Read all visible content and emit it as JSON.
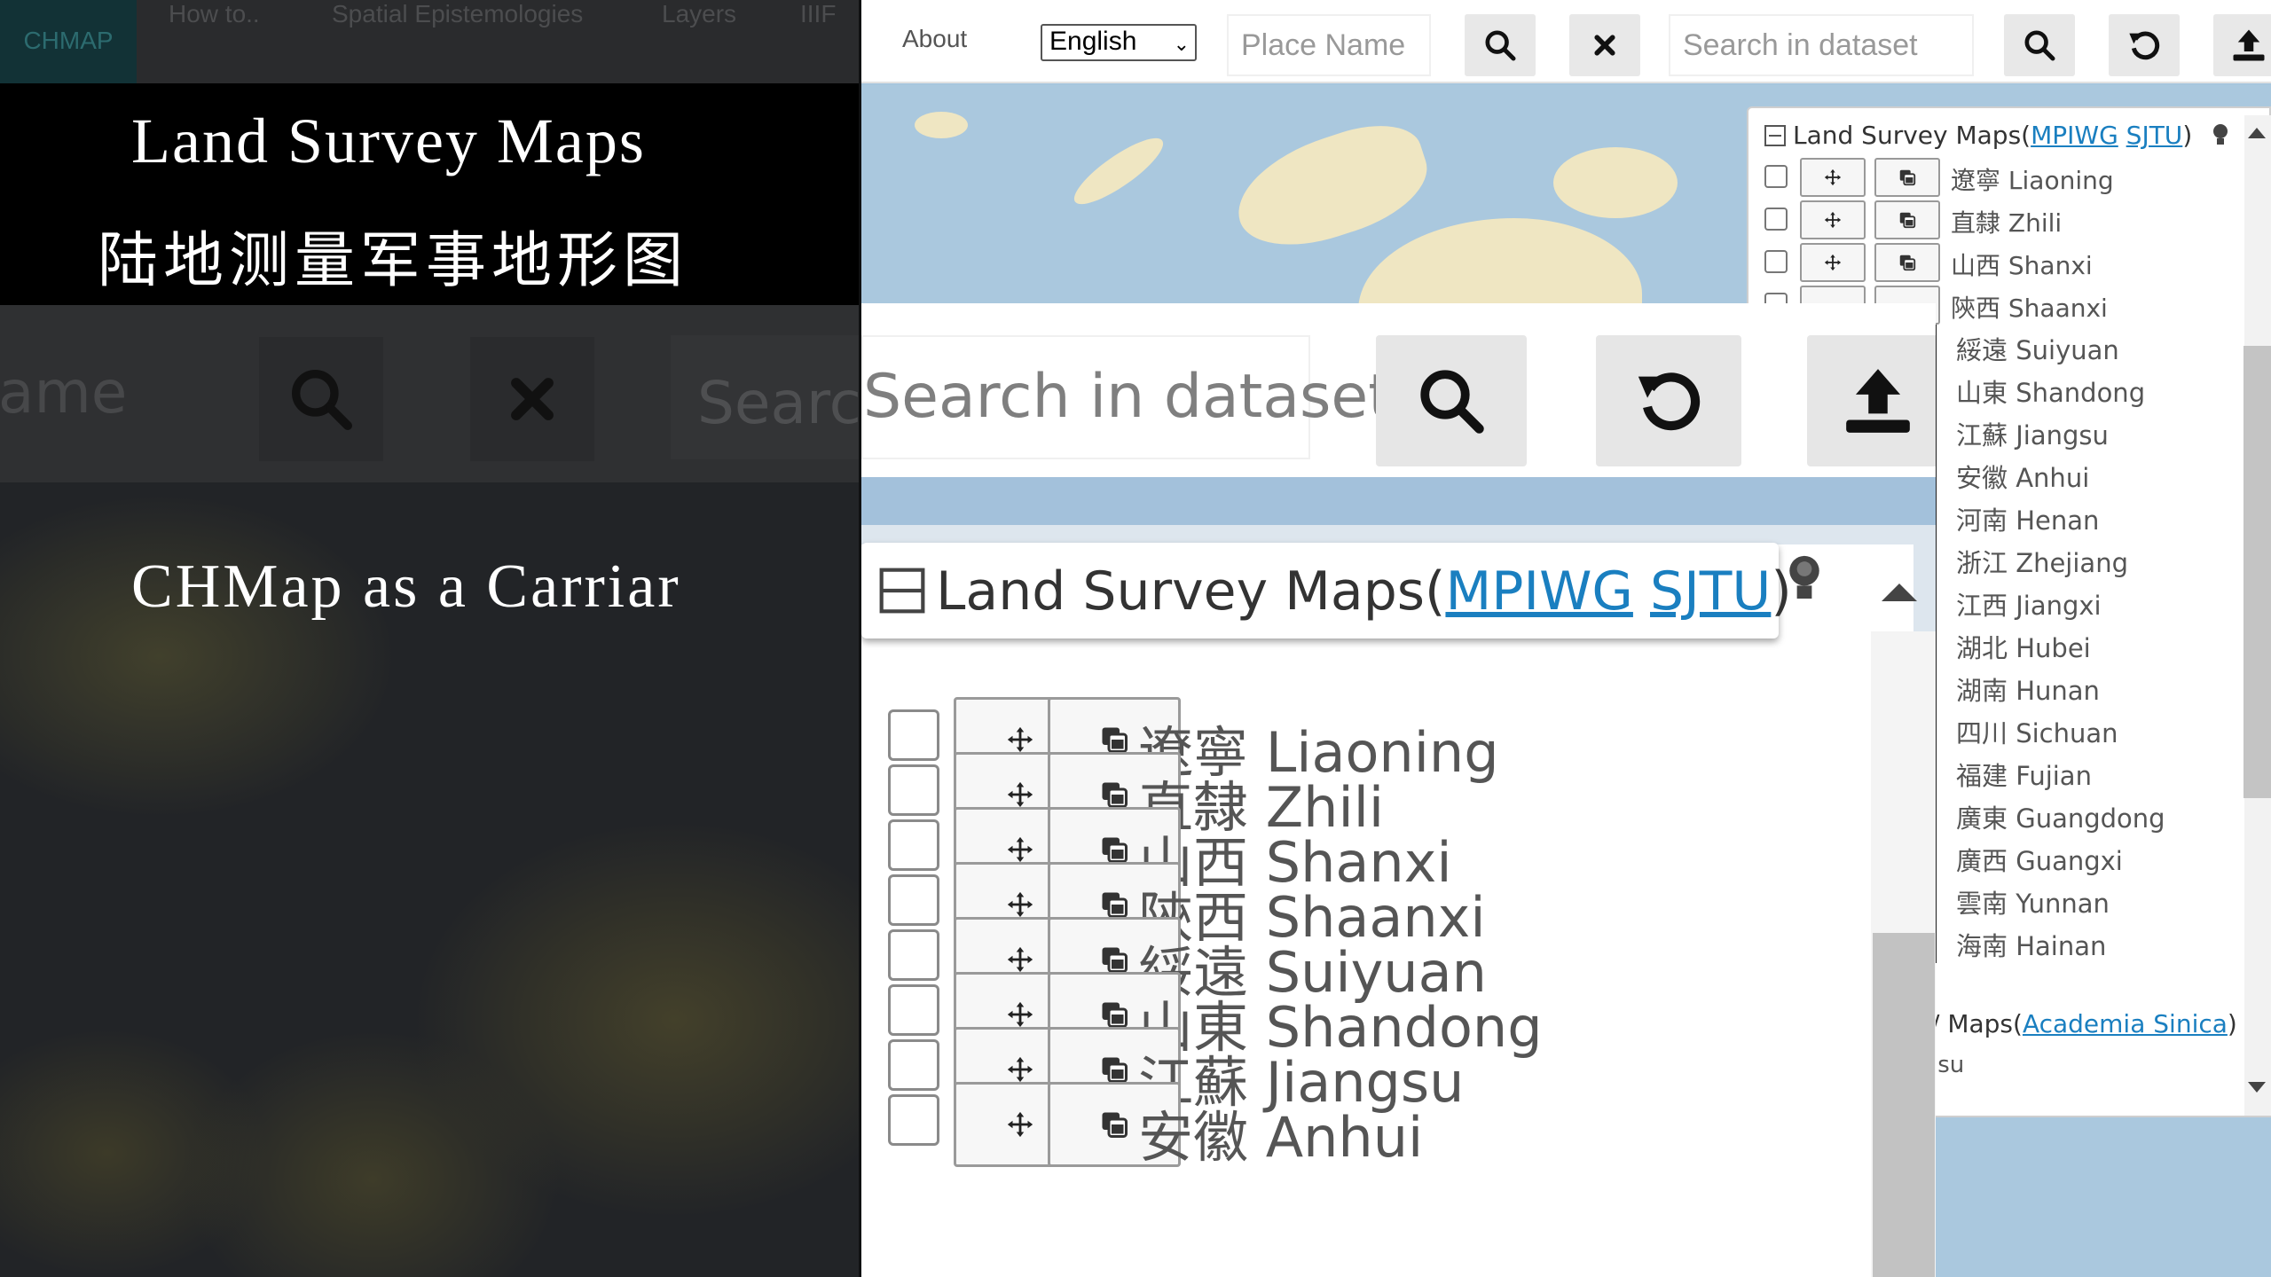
{
  "nav": {
    "brand": "CHMAP",
    "items": [
      "How to..",
      "Spatial Epistemologies",
      "Layers",
      "IIIF",
      "About"
    ]
  },
  "map_controls": {
    "zoom_in": "+",
    "zoom_out": "−"
  },
  "slide": {
    "title_en": "Land Survey Maps",
    "title_zh": "陆地测量军事地形图",
    "subtitle": "CHMap as a Carriar"
  },
  "toolbar": {
    "language": "English",
    "place_placeholder": "Place Name",
    "dataset_placeholder": "Search in dataset",
    "place_placeholder_dim": "ame",
    "dataset_placeholder_dim": "Search in dataset"
  },
  "layer_panel": {
    "group_title": "Land Survey Maps(",
    "group_links": [
      "MPIWG",
      "SJTU"
    ],
    "group_close": ")",
    "provinces": [
      "遼寧 Liaoning",
      "直隸 Zhili",
      "山西 Shanxi",
      "陝西 Shaanxi",
      "綏遠 Suiyuan",
      "山東 Shandong",
      "江蘇 Jiangsu",
      "安徽 Anhui",
      "河南 Henan",
      "浙江 Zhejiang",
      "江西 Jiangxi",
      "湖北 Hubei",
      "湖南 Hunan",
      "四川 Sichuan",
      "福建 Fujian",
      "廣東 Guangdong",
      "廣西 Guangxi",
      "雲南 Yunnan",
      "海南 Hainan"
    ],
    "second_group_prefix": "/ Maps(",
    "second_group_link": "Academia Sinica",
    "second_group_close": ")",
    "second_group_item": "ısu"
  },
  "colors": {
    "link": "#1a7fc0",
    "map_water": "#aac8de",
    "map_land": "#efe6c2",
    "brand_bg": "#123236"
  }
}
